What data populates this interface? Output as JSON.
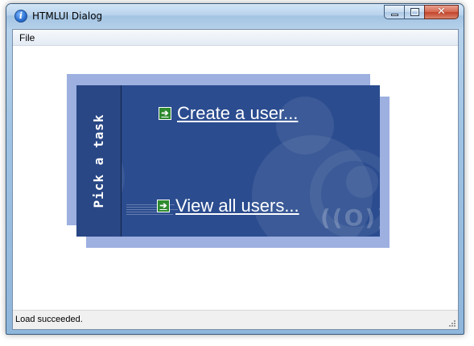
{
  "window": {
    "title": "HTMLUI Dialog",
    "icon": "info-icon"
  },
  "controls": {
    "minimize_icon": "minimize-icon",
    "maximize_icon": "maximize-icon",
    "close_icon": "close-icon",
    "close_glyph": "✕"
  },
  "menubar": {
    "items": [
      {
        "label": "File"
      }
    ]
  },
  "panel": {
    "side_label": "Pick a task",
    "links": [
      {
        "label": "Create a user...",
        "icon": "arrow-right-icon"
      },
      {
        "label": "View all users...",
        "icon": "arrow-right-icon"
      }
    ],
    "colors": {
      "panel": "#2b4c8f",
      "shadow": "#9db0e0",
      "link_icon": "#2e8a2e"
    }
  },
  "statusbar": {
    "text": "Load succeeded."
  }
}
